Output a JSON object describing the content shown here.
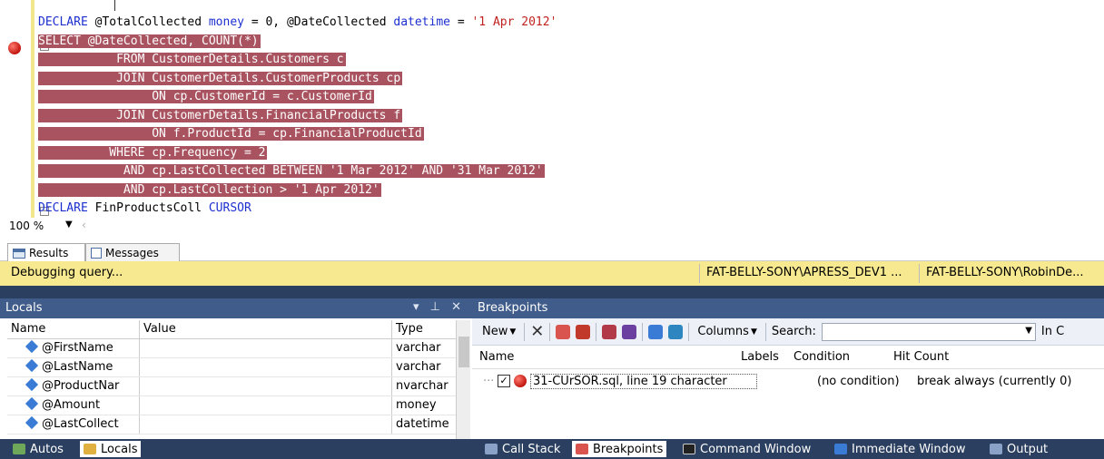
{
  "editor": {
    "lines": [
      {
        "tokens": [
          {
            "t": "DECLARE",
            "c": "kw"
          },
          {
            "t": " @TotalCollected ",
            "c": "plain"
          },
          {
            "t": "money",
            "c": "kw"
          },
          {
            "t": " = 0, @DateCollected ",
            "c": "plain"
          },
          {
            "t": "datetime",
            "c": "kw"
          },
          {
            "t": " = ",
            "c": "plain"
          },
          {
            "t": "'1 Apr 2012'",
            "c": "str"
          }
        ]
      },
      {
        "tokens": [
          {
            "t": "SELECT @DateCollected, COUNT(*)",
            "c": "plain"
          }
        ]
      },
      {
        "tokens": [
          {
            "t": "           FROM CustomerDetails.Customers c",
            "c": "plain"
          }
        ]
      },
      {
        "tokens": [
          {
            "t": "           JOIN CustomerDetails.CustomerProducts cp",
            "c": "plain"
          }
        ]
      },
      {
        "tokens": [
          {
            "t": "                ON cp.CustomerId = c.CustomerId",
            "c": "plain"
          }
        ]
      },
      {
        "tokens": [
          {
            "t": "           JOIN CustomerDetails.FinancialProducts f",
            "c": "plain"
          }
        ]
      },
      {
        "tokens": [
          {
            "t": "                ON f.ProductId = cp.FinancialProductId",
            "c": "plain"
          }
        ]
      },
      {
        "tokens": [
          {
            "t": "          WHERE cp.Frequency = 2",
            "c": "plain"
          }
        ]
      },
      {
        "tokens": [
          {
            "t": "            AND cp.LastCollected BETWEEN '1 Mar 2012' AND '31 Mar 2012'",
            "c": "plain"
          }
        ]
      },
      {
        "tokens": [
          {
            "t": "            AND cp.LastCollection > '1 Apr 2012'",
            "c": "plain"
          }
        ]
      },
      {
        "tokens": [
          {
            "t": "DECLARE",
            "c": "kw"
          },
          {
            "t": " FinProductsColl ",
            "c": "plain"
          },
          {
            "t": "CURSOR",
            "c": "kw"
          }
        ]
      }
    ],
    "zoom": "100 %"
  },
  "result_tabs": {
    "results": "Results",
    "messages": "Messages"
  },
  "status": {
    "message": "Debugging query...",
    "server": "FAT-BELLY-SONY\\APRESS_DEV1 ...",
    "user": "FAT-BELLY-SONY\\RobinDe..."
  },
  "locals": {
    "title": "Locals",
    "columns": [
      "Name",
      "Value",
      "Type"
    ],
    "rows": [
      {
        "name": "@FirstName",
        "value": "",
        "type": "varchar"
      },
      {
        "name": "@LastName",
        "value": "",
        "type": "varchar"
      },
      {
        "name": "@ProductNar",
        "value": "",
        "type": "nvarchar"
      },
      {
        "name": "@Amount",
        "value": "",
        "type": "money"
      },
      {
        "name": "@LastCollect",
        "value": "",
        "type": "datetime"
      }
    ]
  },
  "breakpoints": {
    "title": "Breakpoints",
    "toolbar": {
      "new": "New",
      "columns": "Columns",
      "search_label": "Search:",
      "in_columns": "In C"
    },
    "columns": [
      "Name",
      "Labels",
      "Condition",
      "Hit Count"
    ],
    "row": {
      "name": "31-CUrSOR.sql, line 19 character",
      "labels": "",
      "condition": "(no condition)",
      "hit_count": "break always (currently 0)"
    }
  },
  "bottom_tabs": {
    "autos": "Autos",
    "locals": "Locals",
    "call_stack": "Call Stack",
    "breakpoints": "Breakpoints",
    "command_window": "Command Window",
    "immediate_window": "Immediate Window",
    "output": "Output"
  },
  "colors": {
    "highlight": "#a8535f",
    "keyword": "#1d2fcf",
    "string": "#c0231f",
    "status_bar": "#f7e98f",
    "panel_header": "#405c8a",
    "tab_strip": "#2b3f60"
  }
}
